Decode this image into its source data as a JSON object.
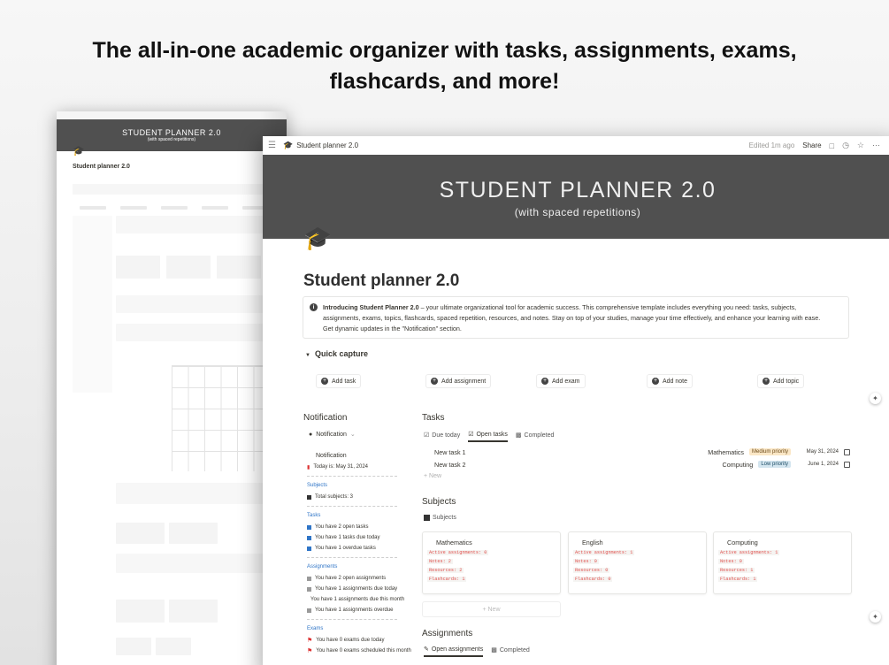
{
  "headline": {
    "line1": "The all-in-one academic organizer with tasks, assignments, exams,",
    "line2": "flashcards, and more!"
  },
  "topbar": {
    "breadcrumb": "Student planner 2.0",
    "edited": "Edited 1m ago",
    "share": "Share"
  },
  "cover": {
    "title": "STUDENT PLANNER 2.0",
    "subtitle": "(with spaced repetitions)"
  },
  "page": {
    "title": "Student planner 2.0",
    "callout_bold": "Introducing Student Planner 2.0",
    "callout_rest_line1": " – your ultimate organizational tool for academic success. This comprehensive template includes everything you need: tasks, subjects,",
    "callout_line2": "assignments, exams, topics, flashcards, spaced repetition, resources, and notes. Stay on top of your studies, manage your time effectively, and enhance your learning with ease.",
    "callout_line3": "Get dynamic updates in the \"Notification\" section."
  },
  "quick_capture": {
    "label": "Quick capture",
    "buttons": [
      "Add task",
      "Add assignment",
      "Add exam",
      "Add note",
      "Add topic"
    ]
  },
  "notification": {
    "heading": "Notification",
    "view_label": "Notification",
    "panel_title": "Notification",
    "today": "Today is: May 31, 2024",
    "subjects_title": "Subjects",
    "total_subjects": "Total subjects: 3",
    "tasks_title": "Tasks",
    "tasks_lines": [
      "You have 2 open tasks",
      "You have 1 tasks due today",
      "You have 1 overdue tasks"
    ],
    "assignments_title": "Assignments",
    "assignments_lines": [
      "You have 2 open assignments",
      "You have 1 assignments due today",
      "You have 1 assignments due this month",
      "You have 1 assignments overdue"
    ],
    "exams_title": "Exams",
    "exams_lines": [
      "You have 0 exams due today",
      "You have 0 exams scheduled this month"
    ]
  },
  "tasks": {
    "heading": "Tasks",
    "tabs": [
      "Due today",
      "Open tasks",
      "Completed"
    ],
    "rows": [
      {
        "name": "New task 1",
        "subject": "Mathematics",
        "priority": "Medium priority",
        "date": "May 31, 2024"
      },
      {
        "name": "New task 2",
        "subject": "Computing",
        "priority": "Low priority",
        "date": "June 1, 2024"
      }
    ],
    "new_label": "+ New",
    "colors": {
      "medium": "#fbe7c6",
      "low": "#d3e5ef"
    }
  },
  "subjects": {
    "heading": "Subjects",
    "view_label": "Subjects",
    "cards": [
      {
        "name": "Mathematics",
        "stats": [
          "Active assignments: 0",
          "Notes: 2",
          "Resources: 2",
          "Flashcards: 1"
        ]
      },
      {
        "name": "English",
        "stats": [
          "Active assignments: 1",
          "Notes: 0",
          "Resources: 0",
          "Flashcards: 0"
        ]
      },
      {
        "name": "Computing",
        "stats": [
          "Active assignments: 1",
          "Notes: 0",
          "Resources: 1",
          "Flashcards: 1"
        ]
      }
    ],
    "new_label": "+ New"
  },
  "assignments": {
    "heading": "Assignments",
    "tabs": [
      "Open assignments",
      "Completed"
    ]
  },
  "back_window": {
    "cover_title": "STUDENT PLANNER 2.0",
    "cover_subtitle": "(with spaced repetitions)",
    "title": "Student planner 2.0"
  }
}
